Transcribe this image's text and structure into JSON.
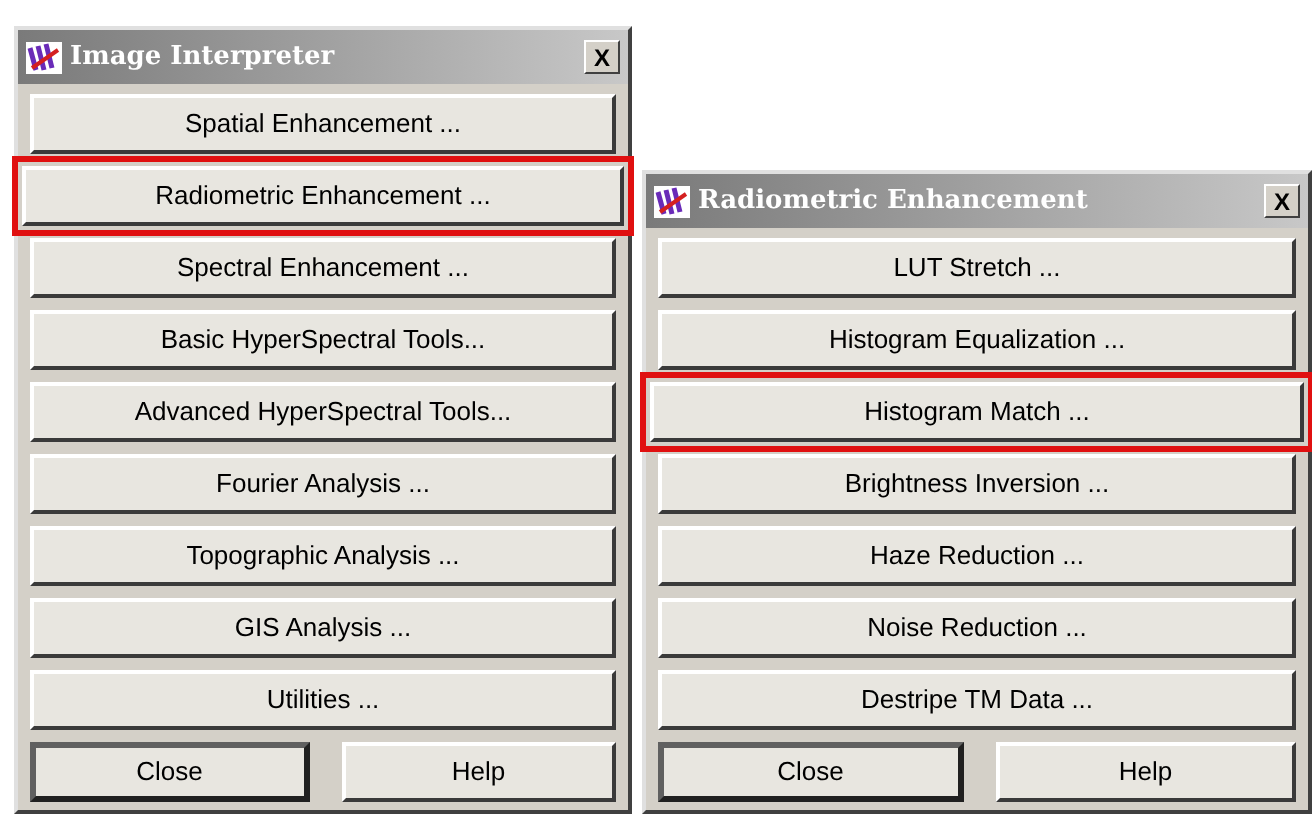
{
  "windows": [
    {
      "title": "Image Interpreter",
      "close_glyph": "X",
      "buttons": [
        {
          "label": "Spatial Enhancement ...",
          "highlighted": false
        },
        {
          "label": "Radiometric Enhancement ...",
          "highlighted": true
        },
        {
          "label": "Spectral Enhancement ...",
          "highlighted": false
        },
        {
          "label": "Basic HyperSpectral Tools...",
          "highlighted": false
        },
        {
          "label": "Advanced HyperSpectral Tools...",
          "highlighted": false
        },
        {
          "label": "Fourier Analysis ...",
          "highlighted": false
        },
        {
          "label": "Topographic Analysis ...",
          "highlighted": false
        },
        {
          "label": "GIS Analysis ...",
          "highlighted": false
        },
        {
          "label": "Utilities ...",
          "highlighted": false
        }
      ],
      "footer": [
        {
          "label": "Close",
          "default": true
        },
        {
          "label": "Help",
          "default": false
        }
      ]
    },
    {
      "title": "Radiometric Enhancement",
      "close_glyph": "X",
      "buttons": [
        {
          "label": "LUT Stretch ...",
          "highlighted": false
        },
        {
          "label": "Histogram Equalization ...",
          "highlighted": false
        },
        {
          "label": "Histogram Match ...",
          "highlighted": true
        },
        {
          "label": "Brightness Inversion ...",
          "highlighted": false
        },
        {
          "label": "Haze Reduction ...",
          "highlighted": false
        },
        {
          "label": "Noise Reduction ...",
          "highlighted": false
        },
        {
          "label": "Destripe TM Data ...",
          "highlighted": false
        }
      ],
      "footer": [
        {
          "label": "Close",
          "default": true
        },
        {
          "label": "Help",
          "default": false
        }
      ]
    }
  ]
}
